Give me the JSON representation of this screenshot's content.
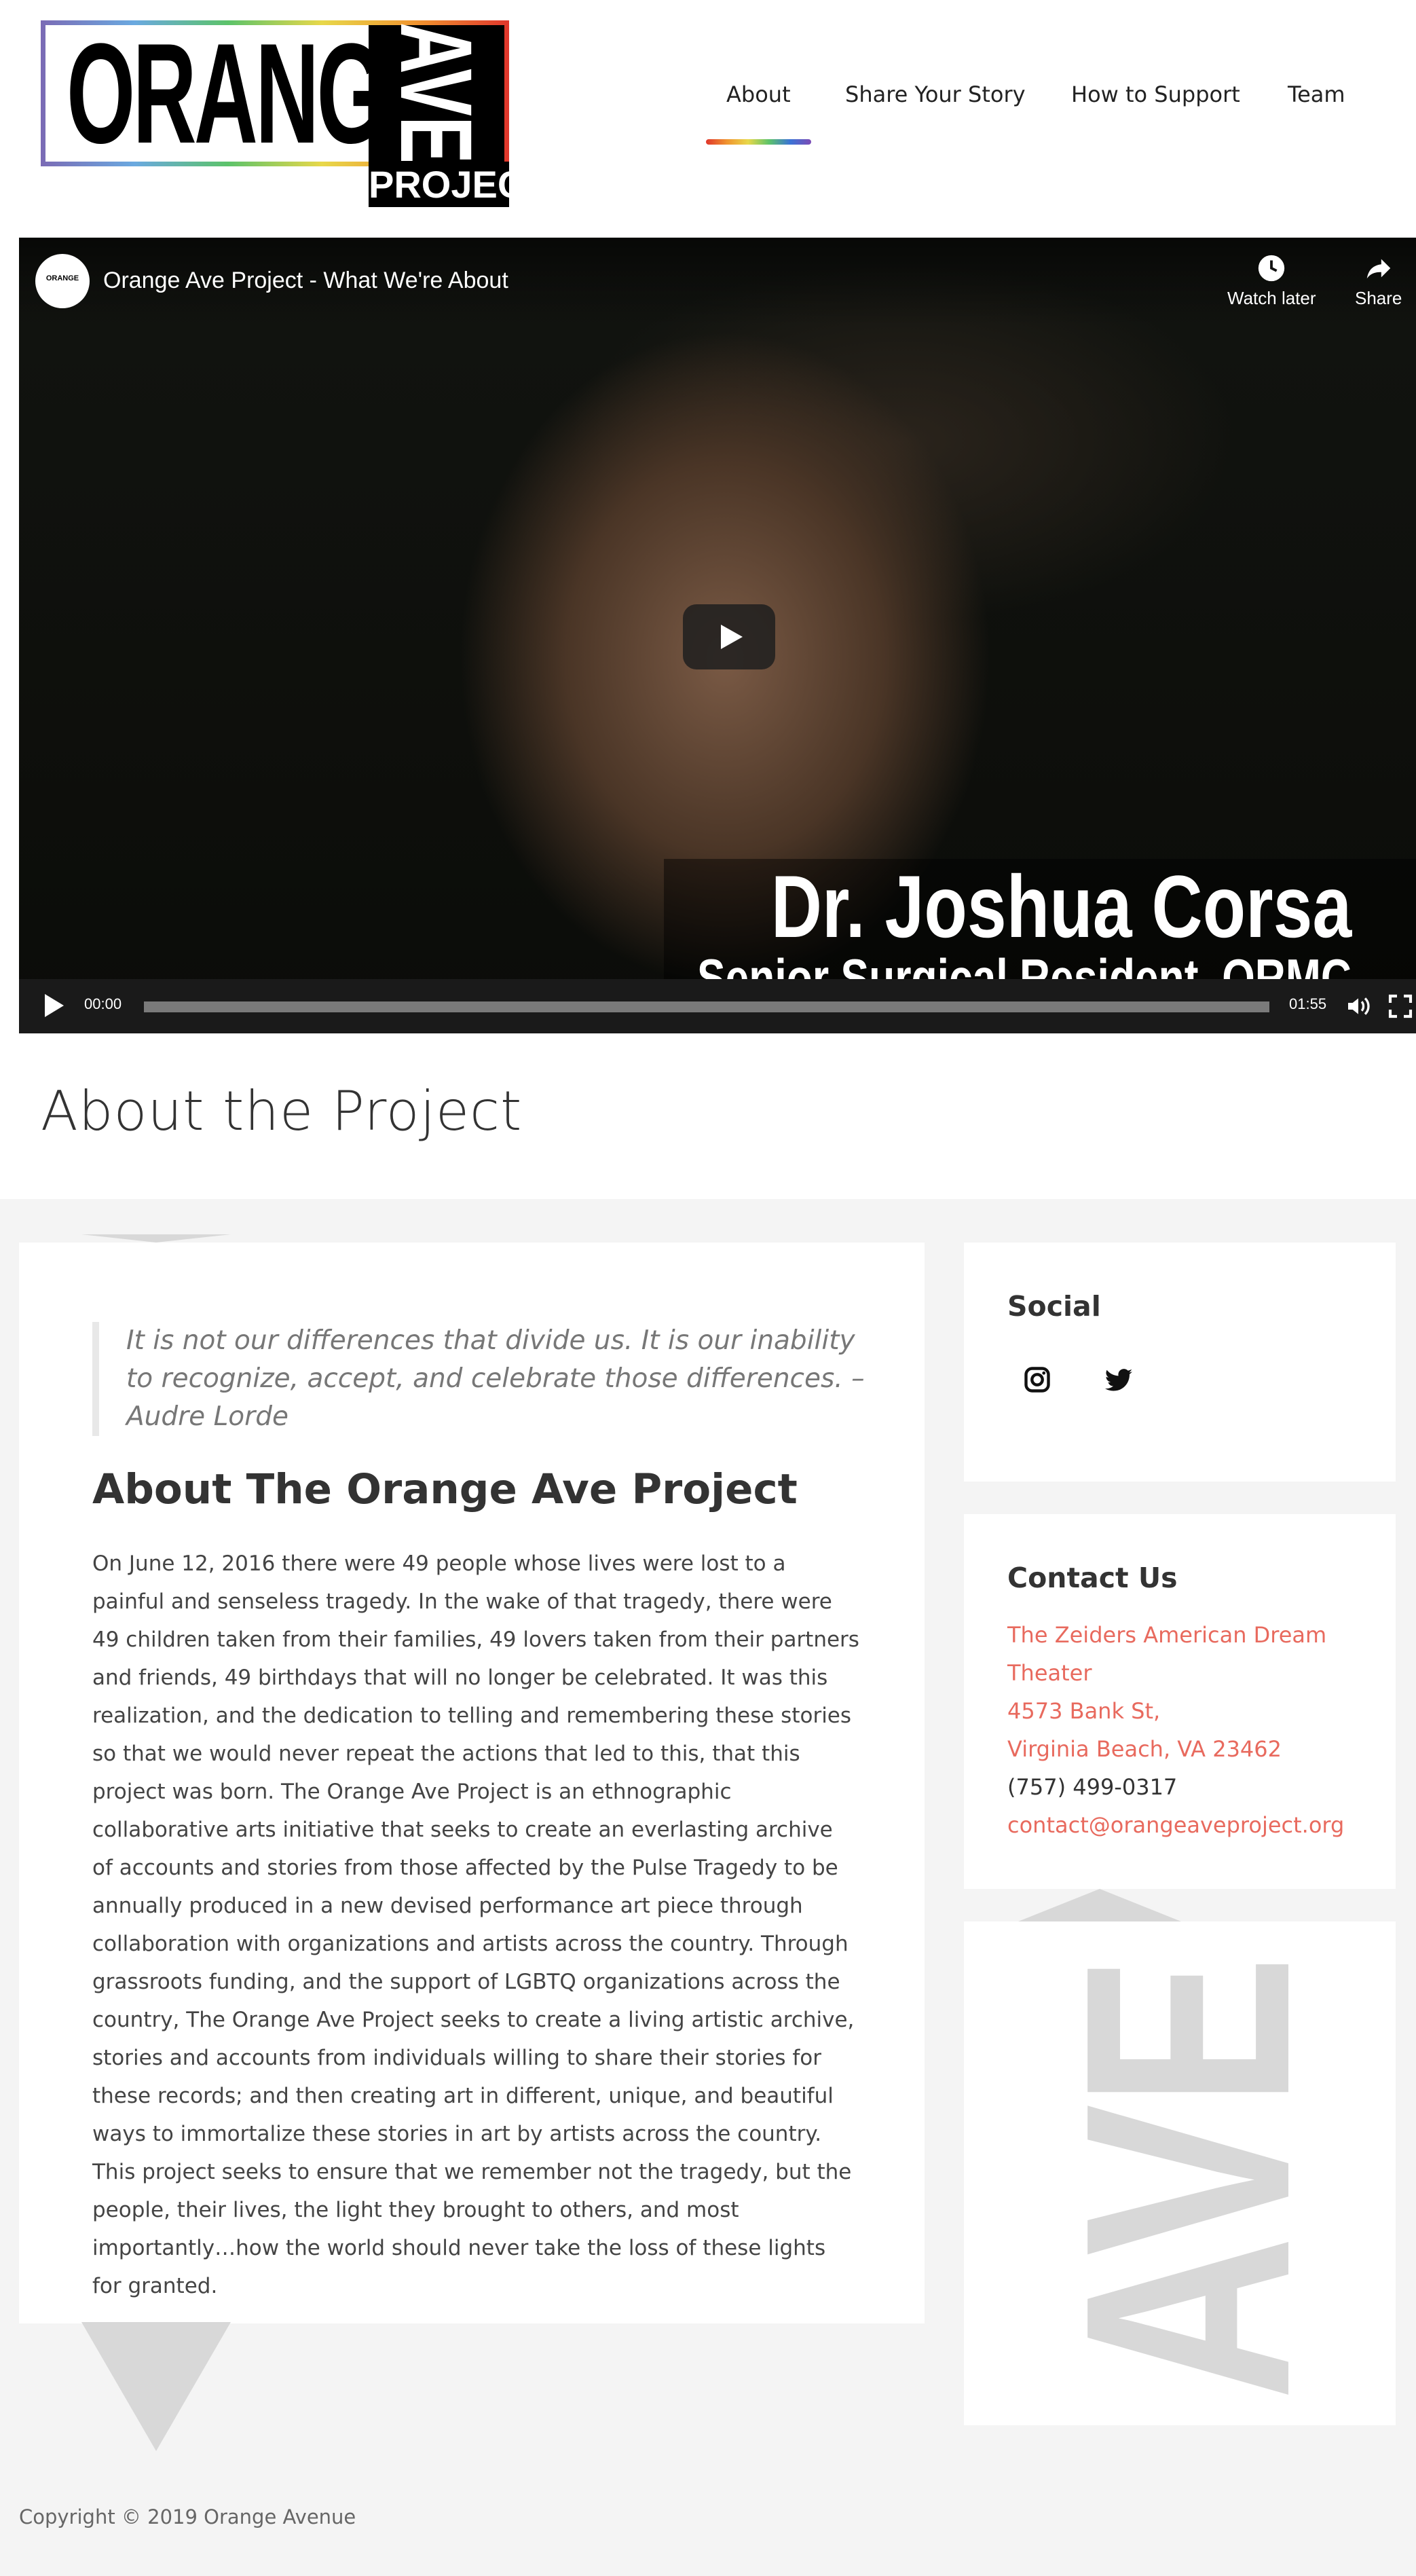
{
  "logo": {
    "word": "ORANGE",
    "ave": "AVE",
    "project": "PROJECT"
  },
  "nav": [
    {
      "label": "About",
      "active": true
    },
    {
      "label": "Share Your Story",
      "active": false
    },
    {
      "label": "How to Support",
      "active": false
    },
    {
      "label": "Team",
      "active": false
    }
  ],
  "video": {
    "channel_badge": "ORANGE",
    "title": "Orange Ave Project - What We're About",
    "watch_later": "Watch later",
    "share": "Share",
    "overlay_name": "Dr. Joshua Corsa",
    "overlay_subtitle": "Senior Surgical Resident, ORMC",
    "current_time": "00:00",
    "duration": "01:55"
  },
  "page_title": "About the Project",
  "main": {
    "quote": "It is not our differences that divide us. It is our inability to recognize, accept, and celebrate those differences. – Audre Lorde",
    "heading": "About The Orange Ave Project",
    "body": "On June 12, 2016 there were 49 people whose lives were lost to a painful and senseless tragedy. In the wake of that tragedy, there were 49 children taken from their families, 49 lovers taken from their partners and friends, 49 birthdays that will no longer be celebrated. It was this realization, and the dedication to telling and remembering these stories so that we would never repeat the actions that led to this, that this project was born. The Orange Ave Project is an ethnographic collaborative arts initiative that seeks to create an everlasting archive of accounts and stories from those affected by the Pulse Tragedy to be annually produced in a new devised performance art piece through collaboration with organizations and artists across the country. Through grassroots funding, and the support of LGBTQ organizations across the country, The Orange Ave Project seeks to create a living artistic archive, stories and accounts from individuals willing to share their stories for these records; and then creating art in different, unique, and beautiful ways to immortalize these stories in art by artists across the country. This project seeks to ensure that we remember not the tragedy, but the people, their lives, the light they brought to others, and most importantly…how the world should never take the loss of these lights for granted."
  },
  "social": {
    "heading": "Social",
    "icons": [
      "instagram-icon",
      "twitter-icon"
    ]
  },
  "contact": {
    "heading": "Contact Us",
    "venue_line1": "The Zeiders American Dream",
    "venue_line2": "Theater",
    "street": "4573 Bank St,",
    "city": "Virginia Beach, VA 23462",
    "phone": "(757) 499-0317",
    "email": "contact@orangeaveproject.org",
    "link_color": "#e86a5e"
  },
  "ave_widget": {
    "text": "AVE"
  },
  "footer": {
    "copyright": "Copyright © 2019 Orange Avenue"
  }
}
